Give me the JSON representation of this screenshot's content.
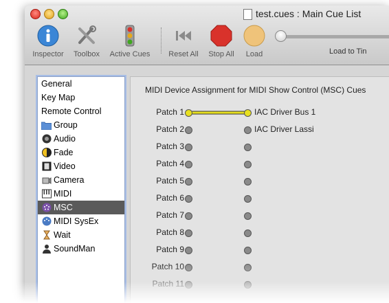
{
  "window": {
    "title": "test.cues : Main Cue List"
  },
  "toolbar": {
    "inspector": "Inspector",
    "toolbox": "Toolbox",
    "active_cues": "Active Cues",
    "reset_all": "Reset All",
    "stop_all": "Stop All",
    "load": "Load",
    "load_to": "Load to Tin"
  },
  "sidebar": {
    "items": [
      {
        "label": "General"
      },
      {
        "label": "Key Map"
      },
      {
        "label": "Remote Control"
      },
      {
        "label": "Group"
      },
      {
        "label": "Audio"
      },
      {
        "label": "Fade"
      },
      {
        "label": "Video"
      },
      {
        "label": "Camera"
      },
      {
        "label": "MIDI"
      },
      {
        "label": "MSC"
      },
      {
        "label": "MIDI SysEx"
      },
      {
        "label": "Wait"
      },
      {
        "label": "SoundMan"
      }
    ],
    "selected": "MSC"
  },
  "panel": {
    "title": "MIDI Device Assignment for MIDI Show Control (MSC) Cues",
    "patches": [
      {
        "label": "Patch 1",
        "device": "IAC Driver Bus 1",
        "connected": true
      },
      {
        "label": "Patch 2",
        "device": "IAC Driver Lassi",
        "connected": false
      },
      {
        "label": "Patch 3",
        "device": "",
        "connected": false
      },
      {
        "label": "Patch 4",
        "device": "",
        "connected": false
      },
      {
        "label": "Patch 5",
        "device": "",
        "connected": false
      },
      {
        "label": "Patch 6",
        "device": "",
        "connected": false
      },
      {
        "label": "Patch 7",
        "device": "",
        "connected": false
      },
      {
        "label": "Patch 8",
        "device": "",
        "connected": false
      },
      {
        "label": "Patch 9",
        "device": "",
        "connected": false
      },
      {
        "label": "Patch 10",
        "device": "",
        "connected": false
      },
      {
        "label": "Patch 11",
        "device": "",
        "connected": false
      }
    ]
  },
  "colors": {
    "connection_line": "#e8e020",
    "selected_row": "#5a5a5a",
    "stop_red": "#d9322b",
    "inspector_blue": "#3b86d6"
  }
}
